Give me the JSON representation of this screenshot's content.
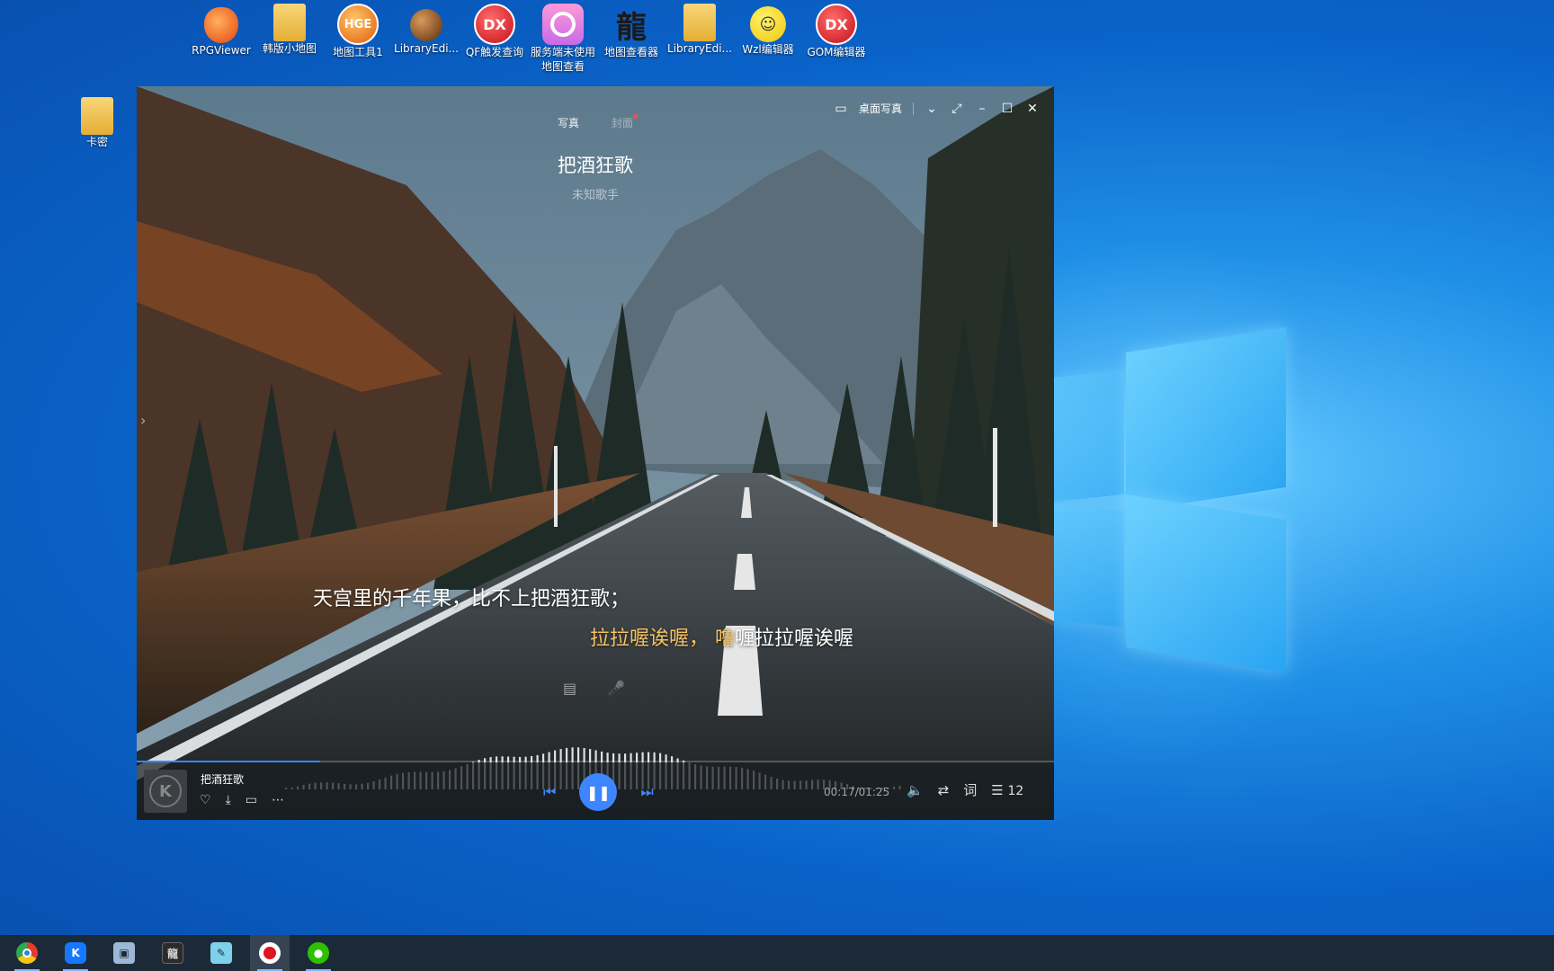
{
  "desktop": {
    "top_icons": [
      {
        "label": "RPGViewer",
        "icon": "apple-icon"
      },
      {
        "label": "韩版小地图",
        "icon": "folder-icon"
      },
      {
        "label": "地图工具1",
        "icon": "hge-icon",
        "glyph": "HGE"
      },
      {
        "label": "LibraryEdi...",
        "icon": "globe-shortcut-icon"
      },
      {
        "label": "QF触发查询",
        "icon": "dx-icon",
        "glyph": "DX"
      },
      {
        "label": "服务端未使用\n地图查看",
        "icon": "ring-icon"
      },
      {
        "label": "地图查看器",
        "icon": "dragon-icon",
        "glyph": "龍"
      },
      {
        "label": "LibraryEdi...",
        "icon": "folder-icon"
      },
      {
        "label": "Wzl编辑器",
        "icon": "smiley-icon",
        "glyph": "☺"
      },
      {
        "label": "GOM编辑器",
        "icon": "dx-icon",
        "glyph": "DX"
      }
    ],
    "left_icon": {
      "label": "卡密",
      "icon": "folder-icon"
    }
  },
  "player": {
    "tabs": [
      "写真",
      "封面"
    ],
    "song_title": "把酒狂歌",
    "artist": "未知歌手",
    "desktop_photo_label": "桌面写真",
    "lyrics": {
      "line1": "天宫里的千年果，比不上把酒狂歌；",
      "line2_sung": "拉拉喔诶喔， 噜",
      "line2_rest": "喱拉拉喔诶喔"
    },
    "bottom": {
      "song_title": "把酒狂歌",
      "cover_glyph": "K",
      "time": "00:17/01:25",
      "lyrics_button": "词",
      "queue_count": "12",
      "progress": 0.2
    },
    "accent_color": "#3d86ff",
    "lyric_highlight_color": "#f3c264"
  },
  "taskbar": {
    "items": [
      "chrome-icon",
      "kugou-icon",
      "remote-desktop-icon",
      "game-icon",
      "notepad-icon",
      "record-icon",
      "wechat-icon"
    ]
  }
}
